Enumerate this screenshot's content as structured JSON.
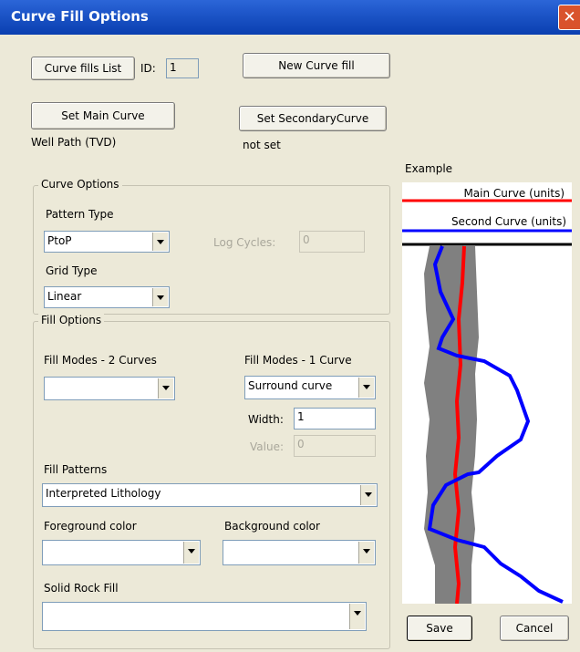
{
  "window": {
    "title": "Curve Fill Options",
    "close_glyph": "✕"
  },
  "top": {
    "curve_fills_list_label": "Curve fills List",
    "id_label": "ID:",
    "id_value": "1",
    "new_curve_fill_label": "New Curve fill",
    "set_main_curve_label": "Set Main Curve",
    "set_secondary_curve_label": "Set SecondaryCurve",
    "main_curve_status": "Well Path (TVD)",
    "secondary_curve_status": "not set"
  },
  "curve_options": {
    "legend": "Curve Options",
    "pattern_type_label": "Pattern Type",
    "pattern_type_value": "PtoP",
    "log_cycles_label": "Log Cycles:",
    "log_cycles_value": "0",
    "grid_type_label": "Grid Type",
    "grid_type_value": "Linear"
  },
  "fill_options": {
    "legend": "Fill Options",
    "fill_modes_2_label": "Fill Modes - 2 Curves",
    "fill_modes_2_value": "",
    "fill_modes_1_label": "Fill Modes - 1 Curve",
    "fill_modes_1_value": "Surround curve",
    "width_label": "Width:",
    "width_value": "1",
    "value_label": "Value:",
    "value_value": "0",
    "fill_patterns_label": "Fill Patterns",
    "fill_patterns_value": "Interpreted Lithology",
    "foreground_label": "Foreground color",
    "foreground_value": "",
    "background_label": "Background color",
    "background_value": "",
    "solid_rock_label": "Solid Rock Fill",
    "solid_rock_value": ""
  },
  "example": {
    "label": "Example",
    "main_curve_label": "Main Curve (units)",
    "second_curve_label": "Second Curve (units)",
    "colors": {
      "main": "#ff0000",
      "second": "#0000ff",
      "fill": "#808080"
    }
  },
  "buttons": {
    "save_label": "Save",
    "cancel_label": "Cancel"
  }
}
